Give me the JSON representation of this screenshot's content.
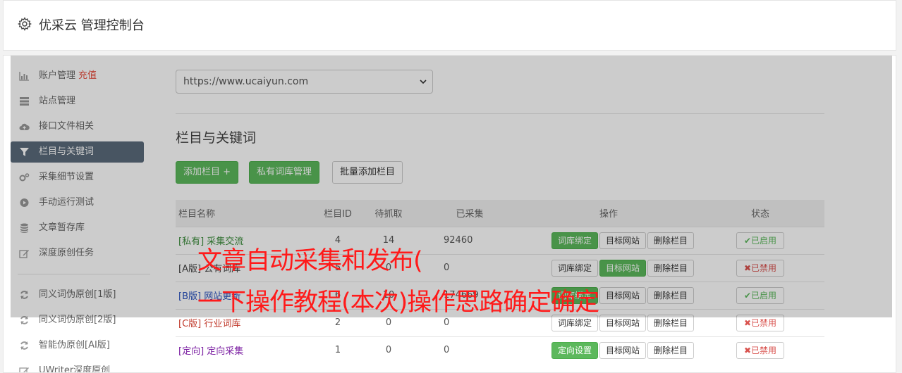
{
  "header": {
    "title": "优采云 管理控制台",
    "icon": "gear-icon"
  },
  "sidebar": {
    "items": [
      {
        "label": "账户管理",
        "extra": "充值",
        "icon": "bar-chart-icon"
      },
      {
        "label": "站点管理",
        "icon": "server-icon"
      },
      {
        "label": "接口文件相关",
        "icon": "cloud-upload-icon"
      },
      {
        "label": "栏目与关键词",
        "icon": "filter-icon",
        "active": true
      },
      {
        "label": "采集细节设置",
        "icon": "cogs-icon"
      },
      {
        "label": "手动运行测试",
        "icon": "play-circle-icon"
      },
      {
        "label": "文章暂存库",
        "icon": "database-icon"
      },
      {
        "label": "深度原创任务",
        "icon": "edit-icon"
      }
    ],
    "items2": [
      {
        "label": "同义词伪原创[1版]",
        "icon": "refresh-icon"
      },
      {
        "label": "同义词伪原创[2版]",
        "icon": "refresh-icon"
      },
      {
        "label": "智能伪原创[AI版]",
        "icon": "refresh-icon"
      },
      {
        "label": "UWriter深度原创",
        "icon": "edit-icon"
      }
    ]
  },
  "site_select": {
    "value": "https://www.ucaiyun.com"
  },
  "section": {
    "title": "栏目与关键词"
  },
  "toolbar": {
    "add_label": "添加栏目 +",
    "private_label": "私有词库管理",
    "batch_label": "批量添加栏目"
  },
  "table": {
    "headers": [
      "栏目名称",
      "栏目ID",
      "待抓取",
      "已采集",
      "操作",
      "状态"
    ],
    "rows": [
      {
        "tag": "[私有]",
        "name": "采集交流",
        "id": "4",
        "pending": "14",
        "collected": "92460",
        "ops": [
          "词库绑定",
          "目标网站",
          "删除栏目"
        ],
        "status": "✔已启用"
      },
      {
        "tag": "[A版]",
        "name": "公有词库",
        "id": "5",
        "pending": "0",
        "collected": "0",
        "ops": [
          "词库绑定",
          "目标网站",
          "删除栏目"
        ],
        "status": "✖已禁用"
      },
      {
        "tag": "[B版]",
        "name": "网站更新",
        "id": "6",
        "pending": "10",
        "collected": "174669",
        "ops": [
          "词库绑定",
          "目标网站",
          "删除栏目"
        ],
        "status": "✔已启用"
      },
      {
        "tag": "[C版]",
        "name": "行业词库",
        "id": "2",
        "pending": "0",
        "collected": "0",
        "ops": [
          "词库绑定",
          "目标网站",
          "删除栏目"
        ],
        "status": "✖已禁用"
      },
      {
        "tag": "[定向]",
        "name": "定向采集",
        "id": "1",
        "pending": "0",
        "collected": "0",
        "ops": [
          "定向设置",
          "目标网站",
          "删除栏目"
        ],
        "status": "✖已禁用"
      }
    ]
  },
  "overlay": {
    "line1": "文章自动采集和发布(",
    "line2": "一下操作教程(本次)操作思路确定确定"
  },
  "colors": {
    "accent_green": "#5cb85c",
    "danger_red": "#d9534f",
    "active_sidebar": "#5b6b7b"
  }
}
